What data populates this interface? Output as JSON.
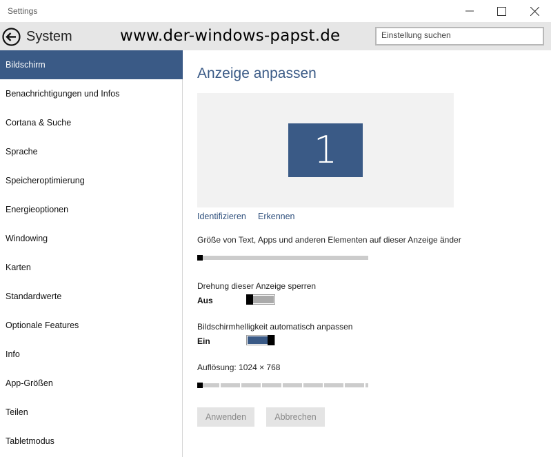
{
  "window": {
    "title": "Settings"
  },
  "header": {
    "title": "System",
    "watermark": "www.der-windows-papst.de",
    "search_placeholder": "Einstellung suchen"
  },
  "sidebar": {
    "items": [
      {
        "label": "Bildschirm",
        "selected": true
      },
      {
        "label": "Benachrichtigungen und Infos"
      },
      {
        "label": "Cortana & Suche"
      },
      {
        "label": "Sprache"
      },
      {
        "label": "Speicheroptimierung"
      },
      {
        "label": "Energieoptionen"
      },
      {
        "label": "Windowing"
      },
      {
        "label": "Karten"
      },
      {
        "label": "Standardwerte"
      },
      {
        "label": "Optionale Features"
      },
      {
        "label": "Info"
      },
      {
        "label": "App-Größen"
      },
      {
        "label": "Teilen"
      },
      {
        "label": "Tabletmodus"
      }
    ]
  },
  "main": {
    "title": "Anzeige anpassen",
    "monitor_number": "1",
    "identify_link": "Identifizieren",
    "detect_link": "Erkennen",
    "scale_label": "Größe von Text, Apps und anderen Elementen auf dieser Anzeige änder",
    "scale_level": 0.0,
    "rotation_label": "Drehung dieser Anzeige sperren",
    "rotation_state": "Aus",
    "rotation_on": false,
    "brightness_label": "Bildschirmhelligkeit automatisch anpassen",
    "brightness_state": "Ein",
    "brightness_on": true,
    "resolution_label": "Auflösung: 1024 × 768",
    "resolution_level": 0.0,
    "apply_label": "Anwenden",
    "cancel_label": "Abbrechen"
  },
  "colors": {
    "accent": "#3a5a86",
    "header_bg": "#e6e6e6",
    "track": "#cccccc"
  }
}
